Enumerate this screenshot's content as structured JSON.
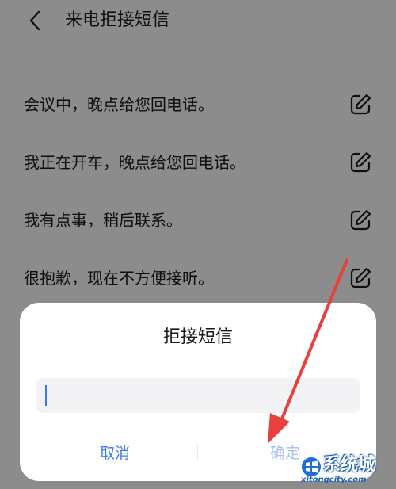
{
  "header": {
    "title": "来电拒接短信"
  },
  "messages": [
    {
      "text": "会议中，晚点给您回电话。"
    },
    {
      "text": "我正在开车，晚点给您回电话。"
    },
    {
      "text": "我有点事，稍后联系。"
    },
    {
      "text": "很抱歉，现在不方便接听。"
    }
  ],
  "dialog": {
    "title": "拒接短信",
    "input_value": "",
    "cancel_label": "取消",
    "confirm_label": "确定"
  },
  "watermark": {
    "brand": "系统城",
    "url": "xitongcity.com"
  },
  "colors": {
    "accent": "#3b7be5",
    "confirm_disabled": "#a9c3ef",
    "annotation": "#e8413d",
    "overlay": "rgba(0,0,0,0.45)"
  },
  "icons": {
    "back": "chevron-left-icon",
    "edit": "edit-icon"
  }
}
